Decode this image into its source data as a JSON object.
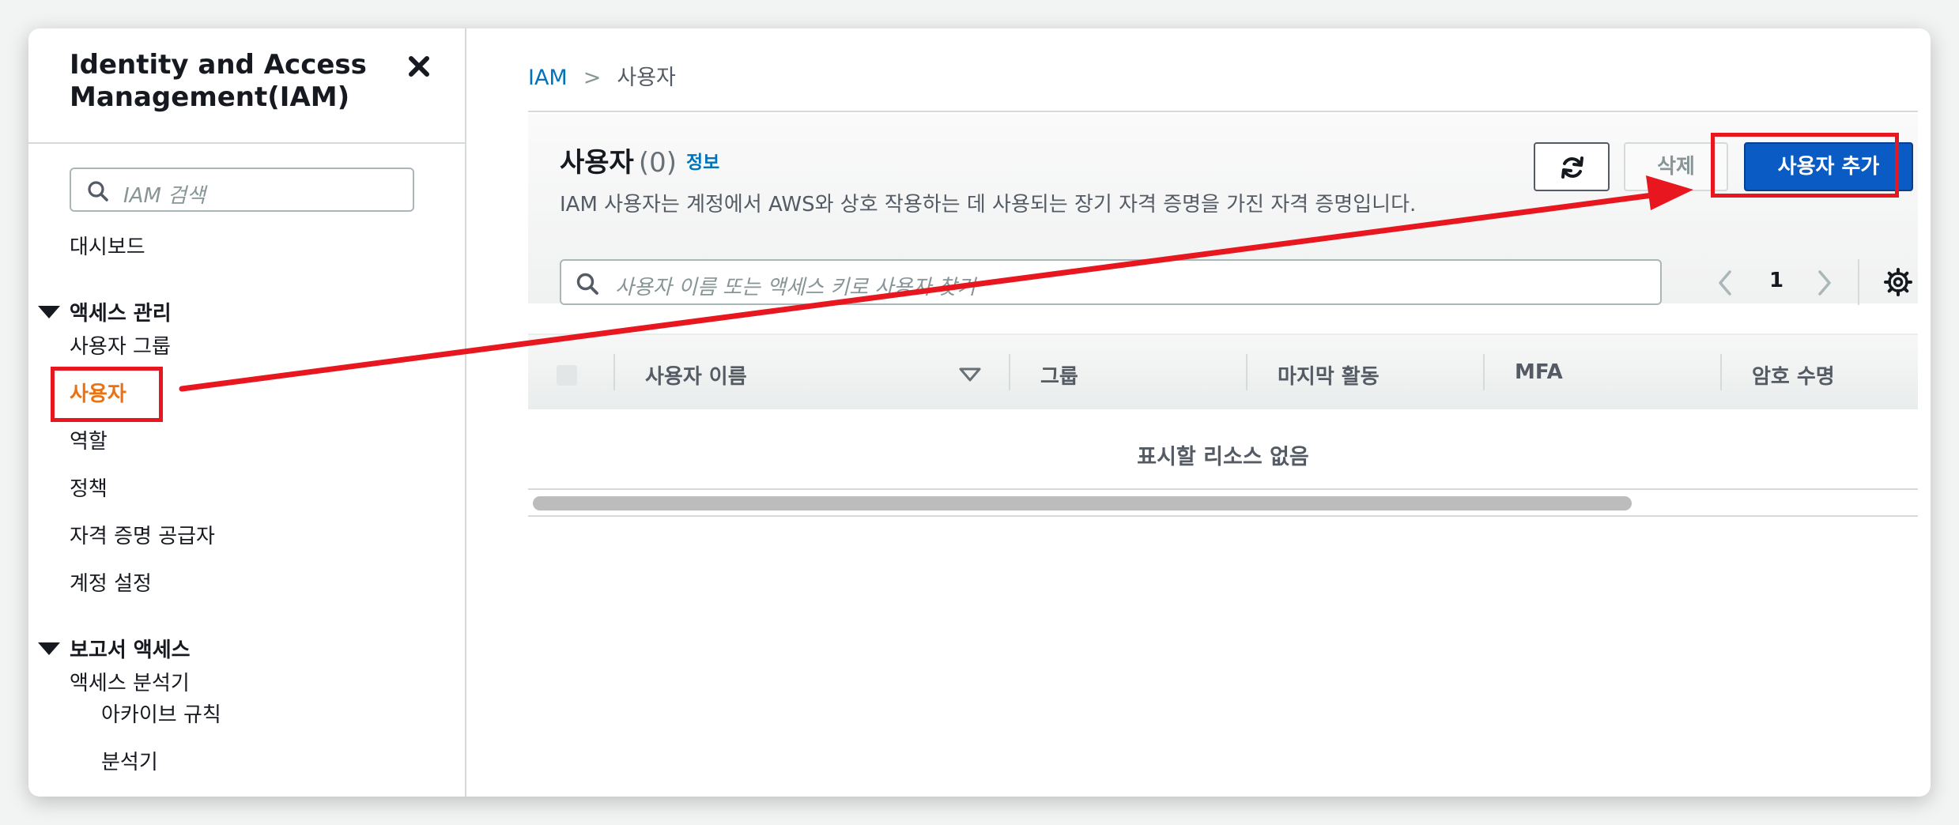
{
  "sidebar": {
    "title": "Identity and Access Management(IAM)",
    "search_placeholder": "IAM 검색",
    "dashboard": "대시보드",
    "access_management": {
      "label": "액세스 관리",
      "items": [
        "사용자 그룹",
        "사용자",
        "역할",
        "정책",
        "자격 증명 공급자",
        "계정 설정"
      ]
    },
    "access_reports": {
      "label": "보고서 액세스",
      "items": [
        "액세스 분석기",
        "아카이브 규칙",
        "분석기"
      ]
    }
  },
  "breadcrumb": {
    "root": "IAM",
    "separator": ">",
    "current": "사용자"
  },
  "panel": {
    "title": "사용자",
    "count": "(0)",
    "info": "정보",
    "description": "IAM 사용자는 계정에서 AWS와 상호 작용하는 데 사용되는 장기 자격 증명을 가진 자격 증명입니다.",
    "delete_label": "삭제",
    "add_user_label": "사용자 추가",
    "search_placeholder": "사용자 이름 또는 액세스 키로 사용자 찾기",
    "page_number": "1",
    "columns": [
      "사용자 이름",
      "그룹",
      "마지막 활동",
      "MFA",
      "암호 수명"
    ],
    "empty_message": "표시할 리소스 없음"
  },
  "colors": {
    "annotation": "#e8161f",
    "primary_button": "#0a5bc4",
    "active_nav": "#ec7211",
    "link": "#0073bb"
  }
}
